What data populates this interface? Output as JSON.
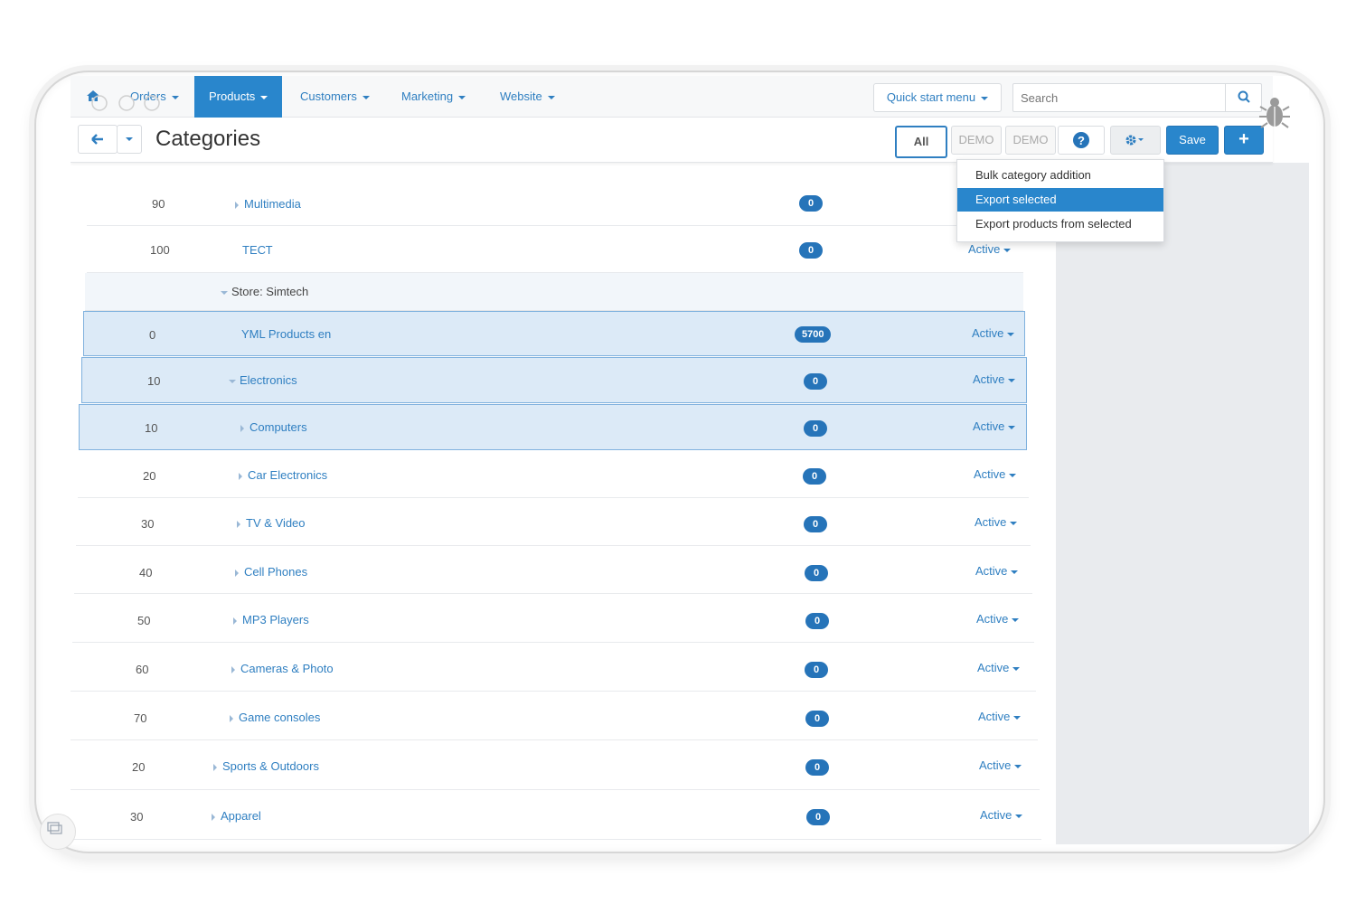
{
  "nav": {
    "items": [
      {
        "label": "Orders"
      },
      {
        "label": "Products"
      },
      {
        "label": "Customers"
      },
      {
        "label": "Marketing"
      },
      {
        "label": "Website"
      }
    ],
    "quick_start": "Quick start menu",
    "search_placeholder": "Search"
  },
  "toolbar": {
    "title": "Categories",
    "all_label": "All",
    "demo_label_1": "DEMO",
    "demo_label_2": "DEMO",
    "save_label": "Save"
  },
  "dropdown": {
    "items": [
      {
        "label": "Bulk category addition"
      },
      {
        "label": "Export selected"
      },
      {
        "label": "Export products from selected"
      }
    ]
  },
  "store": {
    "label": "Store: Simtech"
  },
  "rows_top": [
    {
      "position": "90",
      "name": "Multimedia",
      "count": "0"
    },
    {
      "position": "100",
      "name": "ТЕСТ",
      "count": "0",
      "status": "Active"
    }
  ],
  "rows": [
    {
      "position": "0",
      "name": "YML Products en",
      "count": "5700",
      "status": "Active"
    },
    {
      "position": "10",
      "name": "Electronics",
      "count": "0",
      "status": "Active"
    },
    {
      "position": "10",
      "name": "Computers",
      "count": "0",
      "status": "Active"
    },
    {
      "position": "20",
      "name": "Car Electronics",
      "count": "0",
      "status": "Active"
    },
    {
      "position": "30",
      "name": "TV & Video",
      "count": "0",
      "status": "Active"
    },
    {
      "position": "40",
      "name": "Cell Phones",
      "count": "0",
      "status": "Active"
    },
    {
      "position": "50",
      "name": "MP3 Players",
      "count": "0",
      "status": "Active"
    },
    {
      "position": "60",
      "name": "Cameras & Photo",
      "count": "0",
      "status": "Active"
    },
    {
      "position": "70",
      "name": "Game consoles",
      "count": "0",
      "status": "Active"
    },
    {
      "position": "20",
      "name": "Sports & Outdoors",
      "count": "0",
      "status": "Active"
    },
    {
      "position": "30",
      "name": "Apparel",
      "count": "0",
      "status": "Active"
    }
  ],
  "colors": {
    "accent": "#2986cc",
    "selected_row": "#dceaf7",
    "badge": "#2674b9"
  }
}
